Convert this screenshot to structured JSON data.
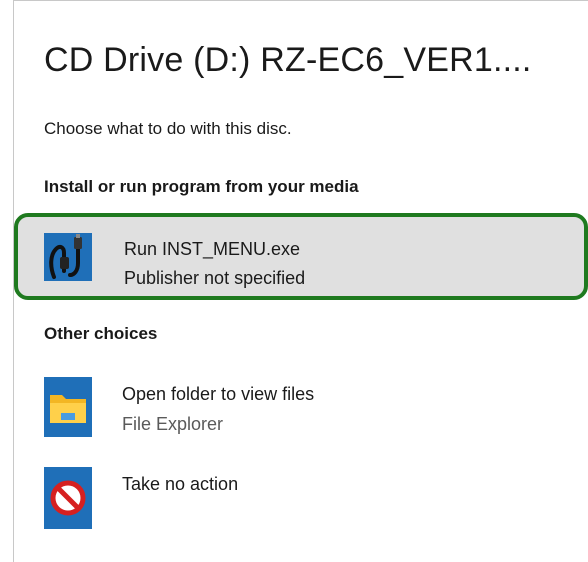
{
  "dialog": {
    "title": "CD Drive (D:) RZ-EC6_VER1....",
    "prompt": "Choose what to do with this disc."
  },
  "sections": {
    "install_heading": "Install or run program from your media",
    "other_heading": "Other choices"
  },
  "options": {
    "run": {
      "title": "Run INST_MENU.exe",
      "subtitle": "Publisher not specified",
      "icon": "installer-cable-icon",
      "highlight_color": "#1f7a1f"
    },
    "folder": {
      "title": "Open folder to view files",
      "subtitle": "File Explorer",
      "icon": "file-explorer-folder-icon"
    },
    "none": {
      "title": "Take no action",
      "icon": "no-action-icon"
    }
  }
}
